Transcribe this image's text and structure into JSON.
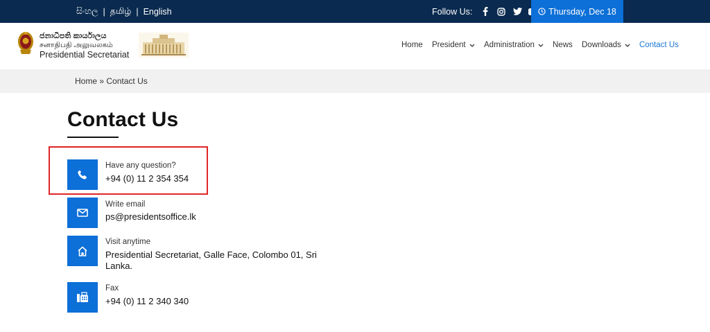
{
  "topbar": {
    "languages": [
      "සිංහල",
      "தமிழ்",
      "English"
    ],
    "follow_label": "Follow Us:",
    "social_icons": [
      "facebook-icon",
      "instagram-icon",
      "twitter-icon",
      "youtube-icon"
    ],
    "date": "Thursday, Dec 18"
  },
  "header": {
    "brand_si": "ජනාධිපති කාර්යාලය",
    "brand_ta": "சனாதிபதி அலுவலகம்",
    "brand_en": "Presidential Secretariat",
    "nav": [
      "Home",
      "President",
      "Administration",
      "News",
      "Downloads",
      "Contact Us"
    ],
    "active_nav": "Contact Us"
  },
  "breadcrumb": {
    "home": "Home",
    "separator": "»",
    "current": "Contact Us"
  },
  "main": {
    "title": "Contact Us",
    "contacts": [
      {
        "icon": "phone-icon",
        "label": "Have any question?",
        "value": "+94 (0) 11 2 354 354"
      },
      {
        "icon": "mail-icon",
        "label": "Write email",
        "value": "ps@presidentsoffice.lk"
      },
      {
        "icon": "home-icon",
        "label": "Visit anytime",
        "value": "Presidential Secretariat, Galle Face, Colombo 01, Sri Lanka."
      },
      {
        "icon": "fax-icon",
        "label": "Fax",
        "value": "+94 (0) 11 2 340 340"
      }
    ]
  },
  "colors": {
    "topbar_bg": "#0a2a4f",
    "accent": "#0d6fd8",
    "highlight": "#e02424"
  }
}
